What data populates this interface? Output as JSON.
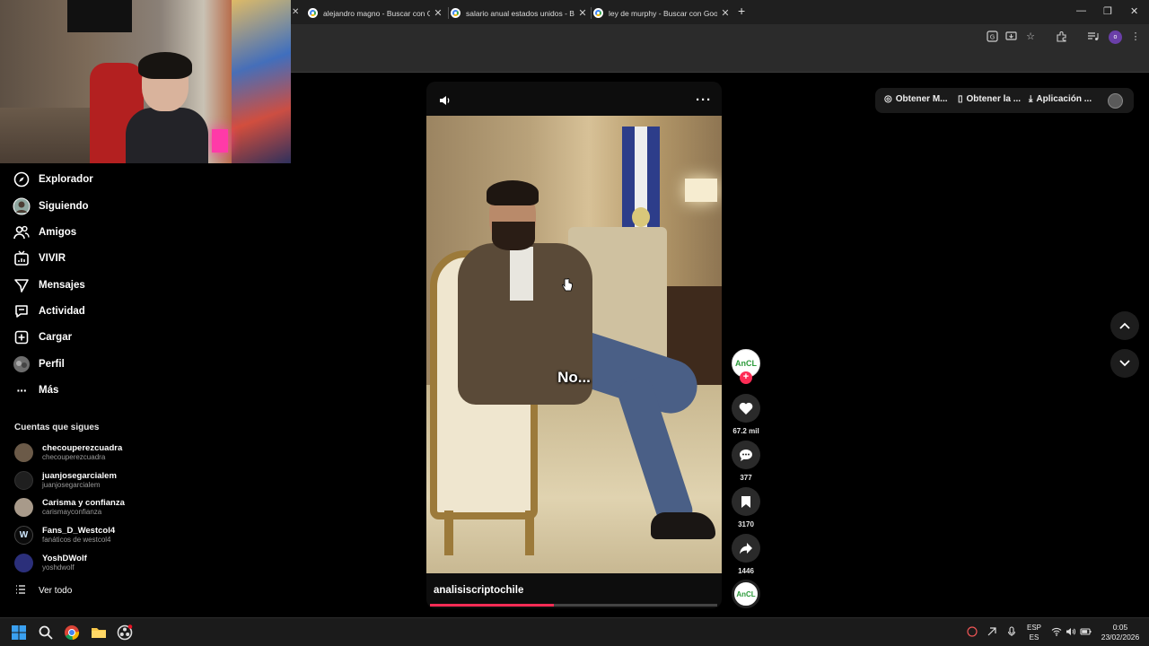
{
  "browser": {
    "tabs": [
      {
        "title": "alejandro magno - Buscar con Google"
      },
      {
        "title": "salario anual estados unidos - Buscar con Google"
      },
      {
        "title": "ley de murphy - Buscar con Google"
      }
    ],
    "profile_initial": "o"
  },
  "sidebar": {
    "items": [
      {
        "label": "Explorador",
        "icon": "compass-icon"
      },
      {
        "label": "Siguiendo",
        "icon": "following-avatar-icon"
      },
      {
        "label": "Amigos",
        "icon": "friends-icon"
      },
      {
        "label": "VIVIR",
        "icon": "live-icon"
      },
      {
        "label": "Mensajes",
        "icon": "messages-icon"
      },
      {
        "label": "Actividad",
        "icon": "activity-icon"
      },
      {
        "label": "Cargar",
        "icon": "upload-icon"
      },
      {
        "label": "Perfil",
        "icon": "profile-avatar-icon"
      },
      {
        "label": "Más",
        "icon": "more-dots-icon"
      }
    ],
    "following_title": "Cuentas que sigues",
    "accounts": [
      {
        "name": "checouperezcuadra",
        "handle": "checouperezcuadra",
        "color": "#6b5a48"
      },
      {
        "name": "juanjosegarcialem",
        "handle": "juanjosegarcialem",
        "color": "#1f1f1f"
      },
      {
        "name": "Carisma y confianza",
        "handle": "carismayconfianza",
        "color": "#a89a8a"
      },
      {
        "name": "Fans_D_Westcol4",
        "handle": "fanáticos de westcol4",
        "color": "#0b0b0b"
      },
      {
        "name": "YoshDWolf",
        "handle": "yoshdwolf",
        "color": "#2b2f7a"
      }
    ],
    "see_all": "Ver todo"
  },
  "video": {
    "caption": "No...",
    "author": "analisiscriptochile",
    "progress": 0.43,
    "channel_badge": "AnCL"
  },
  "actions": {
    "likes": "67.2 mil",
    "comments": "377",
    "saves": "3170",
    "shares": "1446"
  },
  "header": {
    "get_coins": "Obtener M...",
    "get_app": "Obtener la ...",
    "desktop_app": "Aplicación ..."
  },
  "taskbar": {
    "lang_top": "ESP",
    "lang_bottom": "ES",
    "time": "0:05",
    "date": "23/02/2026"
  },
  "colors": {
    "accent": "#fe2c55",
    "background": "#000000"
  }
}
